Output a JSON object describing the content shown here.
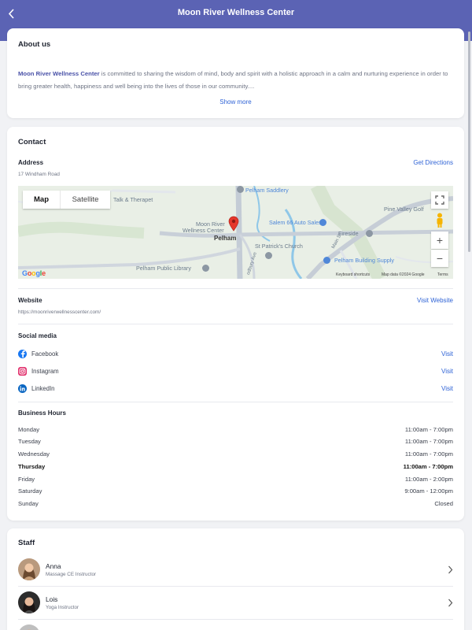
{
  "header": {
    "title": "Moon River Wellness Center"
  },
  "about": {
    "title": "About us",
    "org_name": "Moon River Wellness Center",
    "text": " is committed to sharing the wisdom of mind, body and spirit with a holistic approach in a calm and nurturing experience in order to bring greater health, happiness and well being into the lives of those in our community....",
    "show_more": "Show more"
  },
  "contact": {
    "title": "Contact",
    "address_label": "Address",
    "address_value": "17 Windham Road",
    "directions": "Get Directions",
    "map": {
      "tab_map": "Map",
      "tab_satellite": "Satellite",
      "labels": {
        "talk": "Talk & Therapet",
        "pelham_saddlery": "Pelham Saddlery",
        "pine_valley": "Pine Valley Golf",
        "moon_river": "Moon River",
        "wellness_center": "Wellness Center",
        "pelham": "Pelham",
        "salem66": "Salem 66 Auto Sales",
        "fireside": "Fireside",
        "st_patricks": "St Patrick's Church",
        "building_supply": "Pelham Building Supply",
        "library": "Pelham Public Library",
        "main_st": "Main St",
        "bridge_rd": "Bridge Rd",
        "woodbury": "odbury Ave"
      },
      "google": "Google",
      "keyboard": "Keyboard shortcuts",
      "map_data": "Map data ©2024 Google",
      "terms": "Terms",
      "zoom_in": "+",
      "zoom_out": "−"
    },
    "website_label": "Website",
    "website_url": "https://moonriverwellnesscenter.com/",
    "visit_website": "Visit Website",
    "social_label": "Social media",
    "social": [
      {
        "name": "Facebook",
        "visit": "Visit",
        "color": "#1877f2"
      },
      {
        "name": "Instagram",
        "visit": "Visit",
        "color": "#e1306c"
      },
      {
        "name": "LinkedIn",
        "visit": "Visit",
        "color": "#0a66c2"
      }
    ],
    "hours_label": "Business Hours",
    "hours": [
      {
        "day": "Monday",
        "time": "11:00am - 7:00pm"
      },
      {
        "day": "Tuesday",
        "time": "11:00am - 7:00pm"
      },
      {
        "day": "Wednesday",
        "time": "11:00am - 7:00pm"
      },
      {
        "day": "Thursday",
        "time": "11:00am - 7:00pm"
      },
      {
        "day": "Friday",
        "time": "11:00am - 2:00pm"
      },
      {
        "day": "Saturday",
        "time": "9:00am - 12:00pm"
      },
      {
        "day": "Sunday",
        "time": "Closed"
      }
    ]
  },
  "staff": {
    "title": "Staff",
    "members": [
      {
        "name": "Anna",
        "role": "Massage CE Instructor"
      },
      {
        "name": "Lois",
        "role": "Yoga Instructor"
      },
      {
        "name": "",
        "role": ""
      }
    ]
  },
  "colors": {
    "header": "#5b63b4",
    "link": "#2f63d6",
    "accent_text": "#4a52a8"
  }
}
